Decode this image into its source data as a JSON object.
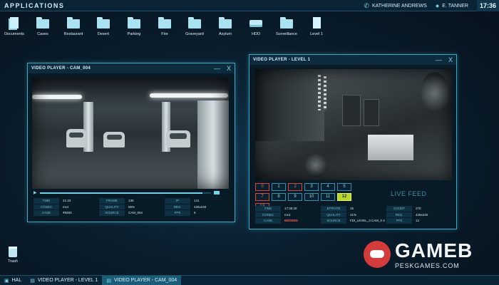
{
  "app_title": "APPLICATIONS",
  "top_bar": {
    "contact_name": "KATHERINE ANDREWS",
    "user_name": "E. TANNER",
    "clock": "17:36"
  },
  "desktop_icons": [
    {
      "label": "Documents",
      "icon": "documents-icon"
    },
    {
      "label": "Cases",
      "icon": "folder-icon"
    },
    {
      "label": "Restaurant",
      "icon": "folder-icon"
    },
    {
      "label": "Desert",
      "icon": "folder-icon"
    },
    {
      "label": "Parking",
      "icon": "folder-icon"
    },
    {
      "label": "Fire",
      "icon": "folder-icon"
    },
    {
      "label": "Graveyard",
      "icon": "folder-icon"
    },
    {
      "label": "Asylum",
      "icon": "folder-icon"
    },
    {
      "label": "HDD",
      "icon": "drive-icon"
    },
    {
      "label": "Surveillance",
      "icon": "folder-icon"
    },
    {
      "label": "Level 1",
      "icon": "page-icon"
    }
  ],
  "window_cam004": {
    "title": "VIDEO PLAYER - CAM_004",
    "minimize": "—",
    "close": "X",
    "playback_progress_percent": 95,
    "info": [
      [
        "TIME",
        "21:33",
        "FRAME",
        "130",
        "IP",
        "141"
      ],
      [
        "CODEC",
        "mc4",
        "QUALITY",
        "55%",
        "RES.",
        "426x240"
      ],
      [
        "CASE",
        "#9283",
        "SOURCE",
        "CAM_004",
        "FPS",
        "6"
      ]
    ]
  },
  "window_level1": {
    "title": "VIDEO PLAYER - LEVEL 1",
    "minimize": "—",
    "close": "X",
    "cameras": [
      {
        "label": "0",
        "state": "alert"
      },
      {
        "label": "1",
        "state": "normal"
      },
      {
        "label": "2",
        "state": "alert"
      },
      {
        "label": "3",
        "state": "normal"
      },
      {
        "label": "4",
        "state": "normal"
      },
      {
        "label": "5",
        "state": "normal"
      },
      {
        "label": "7",
        "state": "alert"
      },
      {
        "label": "8",
        "state": "normal"
      },
      {
        "label": "9",
        "state": "normal"
      },
      {
        "label": "10",
        "state": "normal"
      },
      {
        "label": "11",
        "state": "normal"
      },
      {
        "label": "12",
        "state": "active"
      },
      {
        "label": "13",
        "state": "alert"
      }
    ],
    "live_feed_label": "LIVE FEED",
    "info": [
      [
        "TIME",
        "17:36:28",
        "BITRATE",
        "15",
        "COUNT",
        "270"
      ],
      [
        "CODEC",
        "mc4",
        "QUALITY",
        "41%",
        "RES.",
        "426x240"
      ],
      [
        "CASE",
        "MISSING",
        "SOURCE",
        "FDI_LEVEL_2.CAM_0\n4",
        "FPS",
        "12"
      ]
    ]
  },
  "trash_label": "Trash",
  "taskbar": [
    {
      "label": "HAL",
      "active": false
    },
    {
      "label": "VIDEO PLAYER - LEVEL 1",
      "active": false
    },
    {
      "label": "VIDEO PLAYER - CAM_004",
      "active": true
    }
  ],
  "watermark": {
    "title": "GAMEB",
    "subtitle": "PESKGAMES.COM"
  },
  "colors": {
    "accent": "#3aa9c7",
    "alert": "#ff5a4e",
    "active_camera": "#b9d62a"
  }
}
